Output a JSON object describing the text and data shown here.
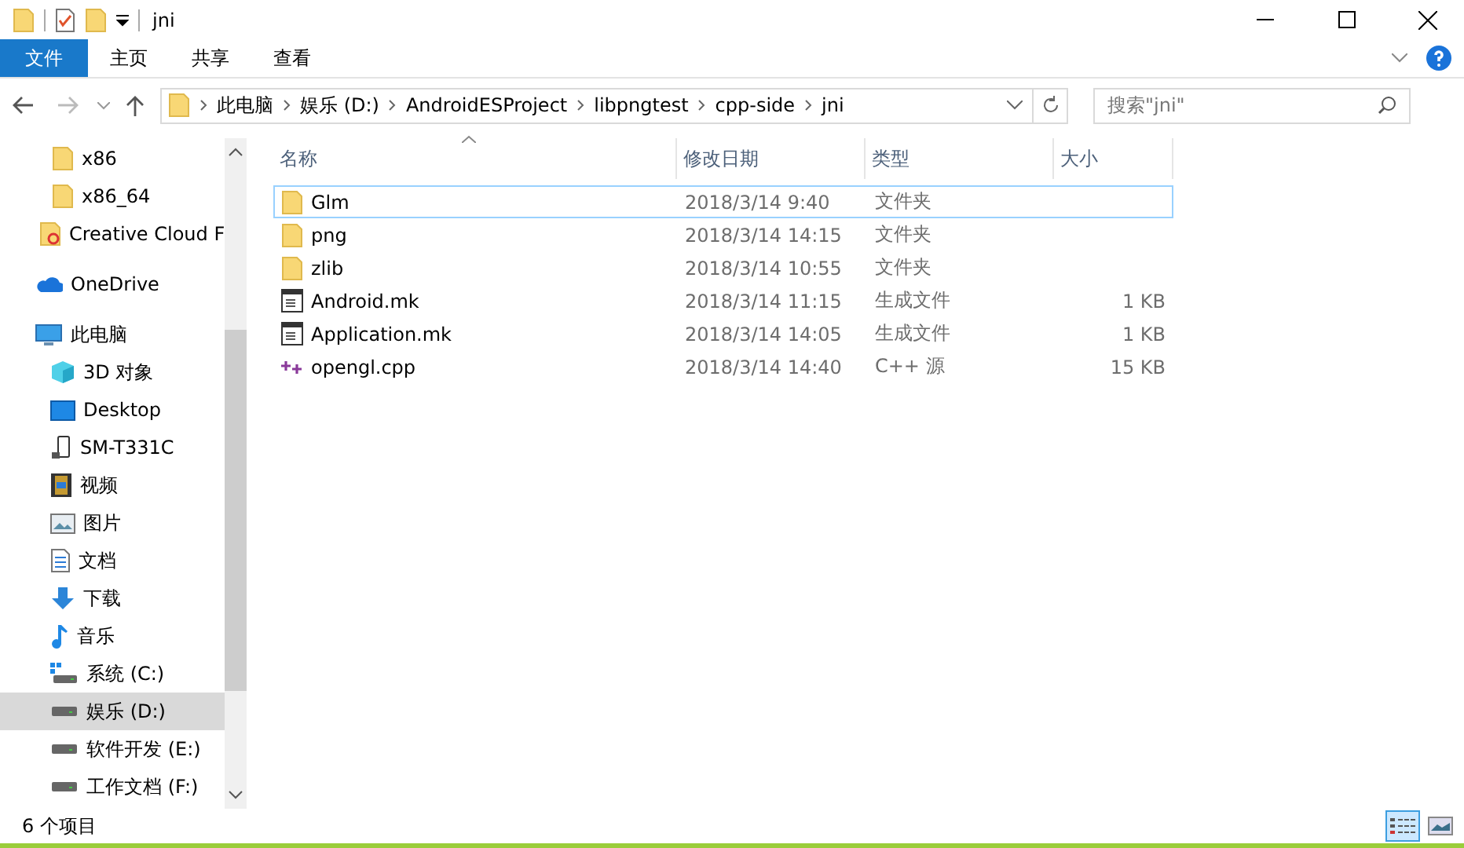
{
  "window": {
    "title": "jni"
  },
  "ribbon_tabs": [
    {
      "label": "文件",
      "selected": true
    },
    {
      "label": "主页",
      "selected": false
    },
    {
      "label": "共享",
      "selected": false
    },
    {
      "label": "查看",
      "selected": false
    }
  ],
  "address": {
    "crumbs": [
      "此电脑",
      "娱乐 (D:)",
      "AndroidESProject",
      "libpngtest",
      "cpp-side",
      "jni"
    ]
  },
  "search": {
    "placeholder": "搜索\"jni\""
  },
  "sidebar": {
    "items": [
      {
        "label": "x86",
        "kind": "folder",
        "selected": false
      },
      {
        "label": "x86_64",
        "kind": "folder",
        "selected": false
      },
      {
        "label": "Creative Cloud F",
        "kind": "cloud-folder",
        "selected": false
      },
      {
        "label": "OneDrive",
        "kind": "onedrive",
        "selected": false
      },
      {
        "label": "此电脑",
        "kind": "pc",
        "selected": false,
        "children": [
          {
            "label": "3D 对象",
            "kind": "cube",
            "selected": false
          },
          {
            "label": "Desktop",
            "kind": "desktop",
            "selected": false
          },
          {
            "label": "SM-T331C",
            "kind": "device",
            "selected": false
          },
          {
            "label": "视频",
            "kind": "video",
            "selected": false
          },
          {
            "label": "图片",
            "kind": "pictures",
            "selected": false
          },
          {
            "label": "文档",
            "kind": "document",
            "selected": false
          },
          {
            "label": "下载",
            "kind": "download",
            "selected": false
          },
          {
            "label": "音乐",
            "kind": "music",
            "selected": false
          },
          {
            "label": "系统 (C:)",
            "kind": "system-drive",
            "selected": false
          },
          {
            "label": "娱乐 (D:)",
            "kind": "drive",
            "selected": true
          },
          {
            "label": "软件开发 (E:)",
            "kind": "drive",
            "selected": false
          },
          {
            "label": "工作文档 (F:)",
            "kind": "drive",
            "selected": false
          }
        ]
      }
    ]
  },
  "table": {
    "columns": [
      "名称",
      "修改日期",
      "类型",
      "大小"
    ],
    "rows": [
      {
        "name": "Glm",
        "kind": "folder",
        "modified": "2018/3/14 9:40",
        "type": "文件夹",
        "focused": true
      },
      {
        "name": "png",
        "kind": "folder",
        "modified": "2018/3/14 14:15",
        "type": "文件夹",
        "focused": false
      },
      {
        "name": "zlib",
        "kind": "folder",
        "modified": "2018/3/14 10:55",
        "type": "文件夹",
        "focused": false
      },
      {
        "name": "Android.mk",
        "kind": "file",
        "modified": "2018/3/14 11:15",
        "type": "生成文件",
        "size": "1 KB",
        "focused": false
      },
      {
        "name": "Application.mk",
        "kind": "file",
        "modified": "2018/3/14 14:05",
        "type": "生成文件",
        "size": "1 KB",
        "focused": false
      },
      {
        "name": "opengl.cpp",
        "kind": "cpp",
        "modified": "2018/3/14 14:40",
        "type": "C++ 源",
        "size": "15 KB",
        "focused": false
      }
    ]
  },
  "status_bar": {
    "count": "6 个项目"
  }
}
